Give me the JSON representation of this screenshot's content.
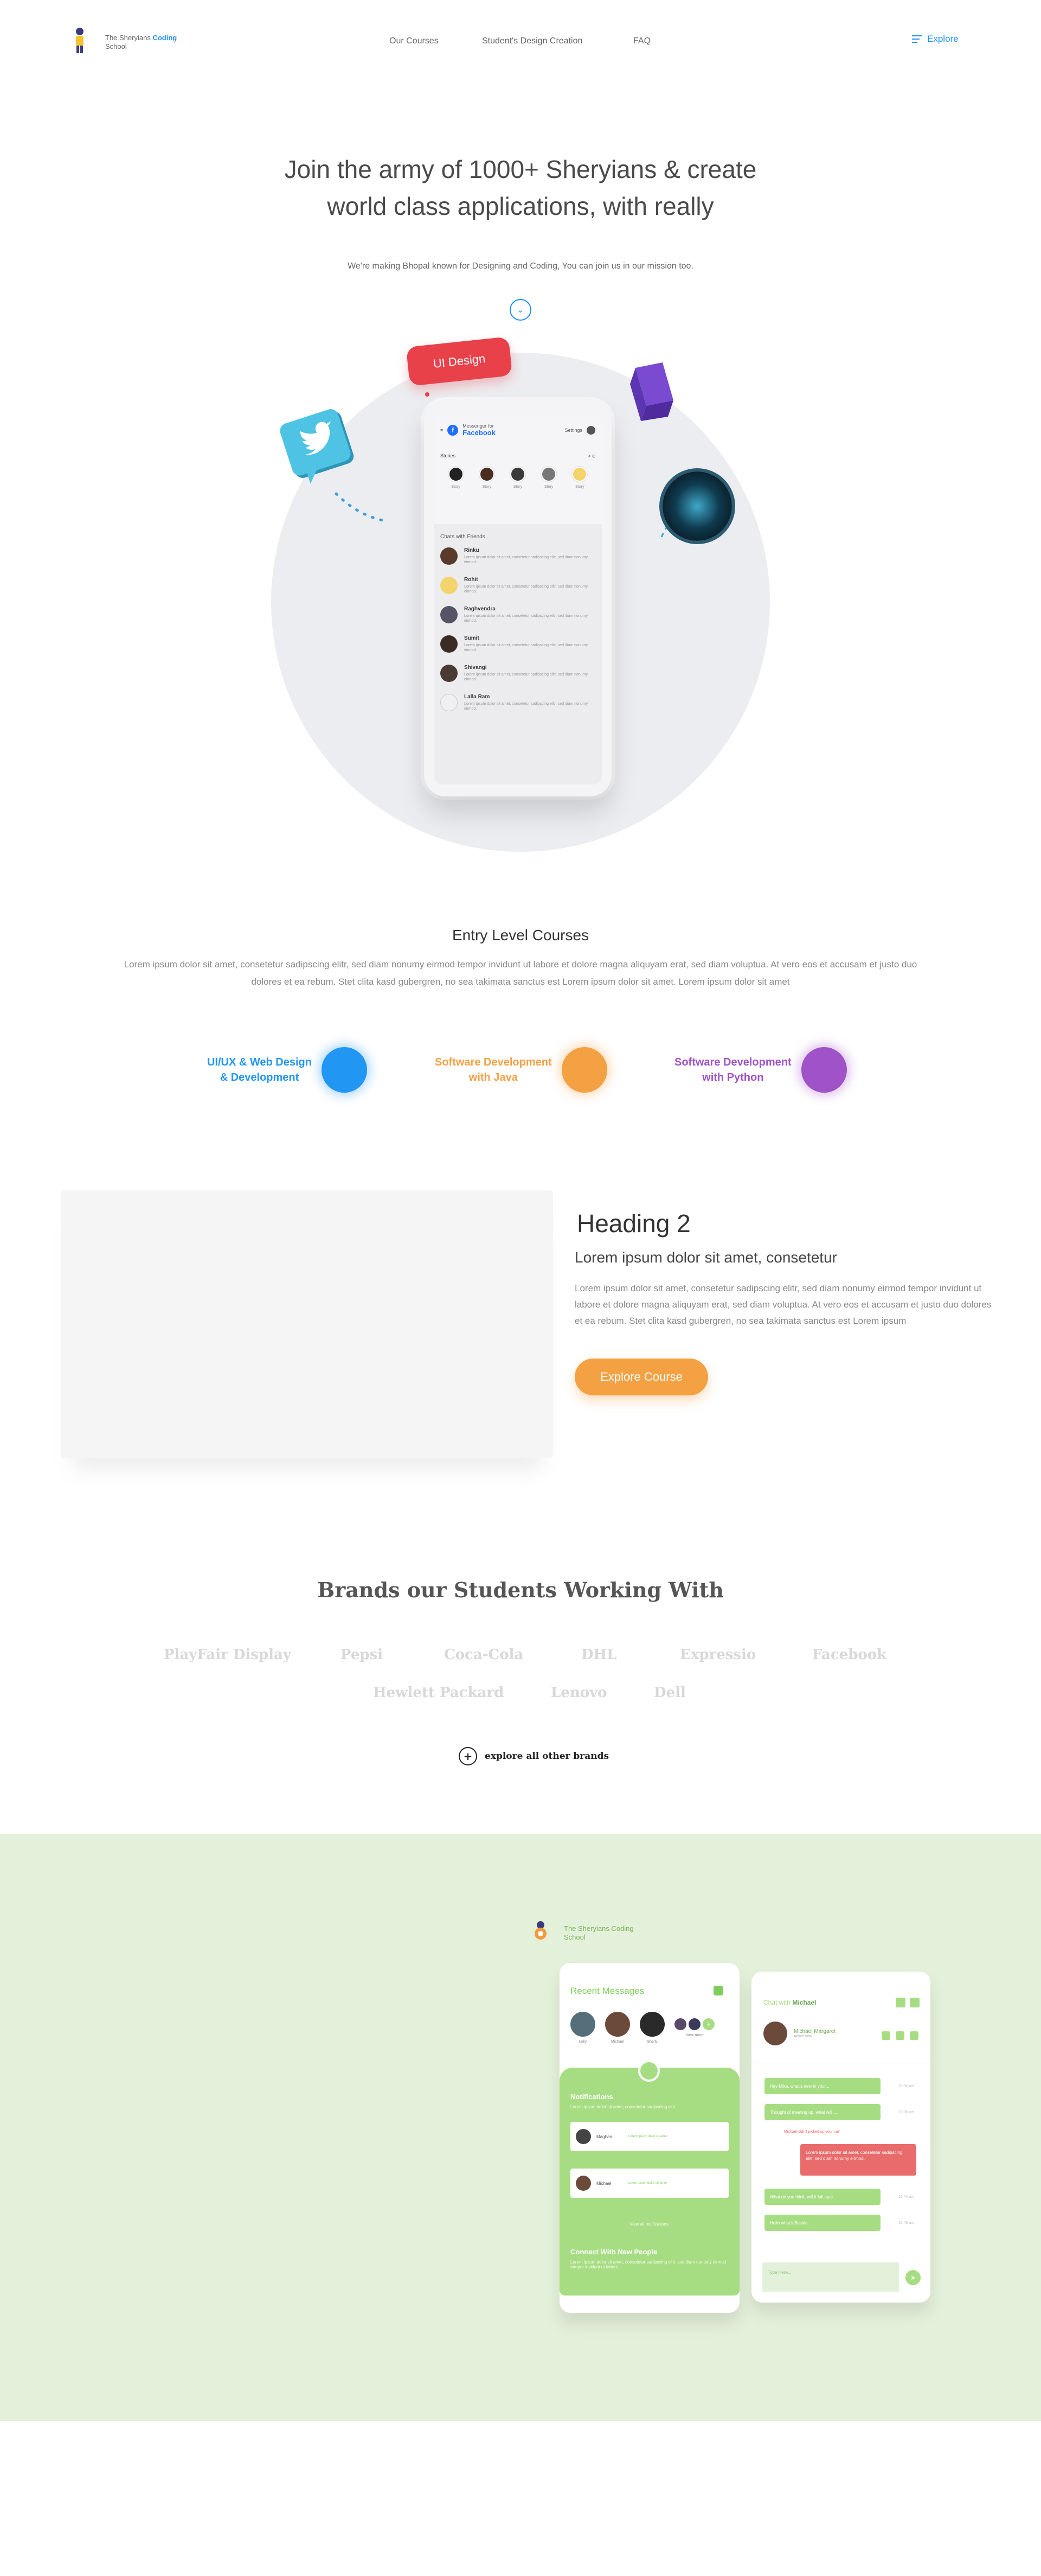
{
  "nav": {
    "logo_text_a": "The Sheryians ",
    "logo_text_b": "Coding",
    "logo_text_c": "School",
    "links": [
      "Our Courses",
      "Student's Design Creation",
      "FAQ"
    ],
    "explore": "Explore"
  },
  "hero": {
    "title_line1": "Join the army of 1000+ Sheryians & create",
    "title_line2": "world class applications, with really",
    "subtitle": "We're making Bhopal known for Designing and Coding, You can join us in our mission too.",
    "scroll_icon": "chevron-down-icon",
    "badge": "UI Design",
    "phone": {
      "small_label": "Messenger for",
      "app": "Facebook",
      "settings": "Settings",
      "stories_label": "Stories",
      "stories": [
        "Story",
        "Story",
        "Story",
        "Story",
        "Story"
      ],
      "chats_label": "Chats with Friends",
      "chats": [
        {
          "name": "Rinku",
          "msg": "Lorem ipsum dolor sit amet, consetetur sadipscing elitr, sed diam nonumy eirmod."
        },
        {
          "name": "Rohit",
          "msg": "Lorem ipsum dolor sit amet, consetetur sadipscing elitr, sed diam nonumy eirmod."
        },
        {
          "name": "Raghvendra",
          "msg": "Lorem ipsum dolor sit amet, consetetur sadipscing elitr, sed diam nonumy eirmod."
        },
        {
          "name": "Sumit",
          "msg": "Lorem ipsum dolor sit amet, consetetur sadipscing elitr, sed diam nonumy eirmod."
        },
        {
          "name": "Shivangi",
          "msg": "Lorem ipsum dolor sit amet, consetetur sadipscing elitr, sed diam nonumy eirmod."
        },
        {
          "name": "Lalla Ram",
          "msg": "Lorem ipsum dolor sit amet, consetetur sadipscing elitr, sed diam nonumy eirmod."
        }
      ]
    }
  },
  "entry": {
    "title": "Entry Level Courses",
    "text": "Lorem ipsum dolor sit amet, consetetur sadipscing elitr, sed diam nonumy eirmod tempor invidunt ut labore et dolore magna aliquyam erat, sed diam voluptua. At vero eos et accusam et justo duo dolores et ea rebum. Stet clita kasd gubergren, no sea takimata sanctus est Lorem ipsum dolor sit amet. Lorem ipsum dolor sit amet",
    "courses": [
      {
        "line1": "UI/UX & Web Design",
        "line2": "& Development",
        "color": "#2196f3"
      },
      {
        "line1": "Software Development",
        "line2": "with Java",
        "color": "#f4a144"
      },
      {
        "line1": "Software Development",
        "line2": "with Python",
        "color": "#a052c8"
      }
    ]
  },
  "feature": {
    "heading": "Heading 2",
    "subheading": "Lorem ipsum dolor sit amet, consetetur",
    "text": "Lorem ipsum dolor sit amet, consetetur sadipscing elitr, sed diam nonumy eirmod tempor invidunt ut labore et dolore magna aliquyam erat, sed diam voluptua. At vero eos et accusam et justo duo dolores et ea rebum. Stet clita kasd gubergren, no sea takimata sanctus est Lorem ipsum",
    "button": "Explore Course"
  },
  "brands": {
    "title": "Brands our Students Working With",
    "row1": [
      "PlayFair Display",
      "Pepsi",
      "Coca-Cola",
      "DHL",
      "Expressio",
      "Facebook"
    ],
    "row2": [
      "Hewlett Packard",
      "Lenovo",
      "Dell"
    ],
    "explore": "explore all other brands"
  },
  "showcase": {
    "logo_line1": "The Sheryians Coding",
    "logo_line2": "School",
    "left_phone": {
      "title": "Recent Messages",
      "avatars": [
        "Lolly",
        "Michael",
        "Shelly",
        "Jason",
        "Sumit"
      ],
      "more_label": "View more",
      "notif_title": "Notifications",
      "notif_sub": "Lorem ipsum dolor sit amet, consetetur sadipscing elitr.",
      "items": [
        {
          "name": "Maghan",
          "meta": "Lorem ipsum dolor sit amet"
        },
        {
          "name": "Michael",
          "meta": "Lorem ipsum dolor sit amet"
        }
      ],
      "view_all": "View all notifications",
      "connect_title": "Connect With New People",
      "connect_sub": "Lorem ipsum dolor sit amet, consetetur sadipscing elitr, sed diam nonumy eirmod tempor invidunt ut labore."
    },
    "right_phone": {
      "title_a": "Chat with ",
      "title_b": "Michael",
      "profile_name": "Michael Margaret",
      "profile_status": "Active now",
      "messages": [
        {
          "text": "Hey Mike, what's new in your...",
          "time": "10:34 am"
        },
        {
          "text": "Thought of meeting up, what will ...",
          "time": "10:36 am"
        }
      ],
      "typing": "Michael didn't picked up your call",
      "red_msg": "Lorem ipsum dolor sit amet, consetetur sadipscing elitr, sed diam nonumy eirmod.",
      "messages2": [
        {
          "text": "What do you think, will it fall apar...",
          "time": "10:44 am"
        },
        {
          "text": "Hello what's Beside",
          "time": "10:46 am"
        }
      ],
      "input_placeholder": "Type Here..."
    }
  }
}
